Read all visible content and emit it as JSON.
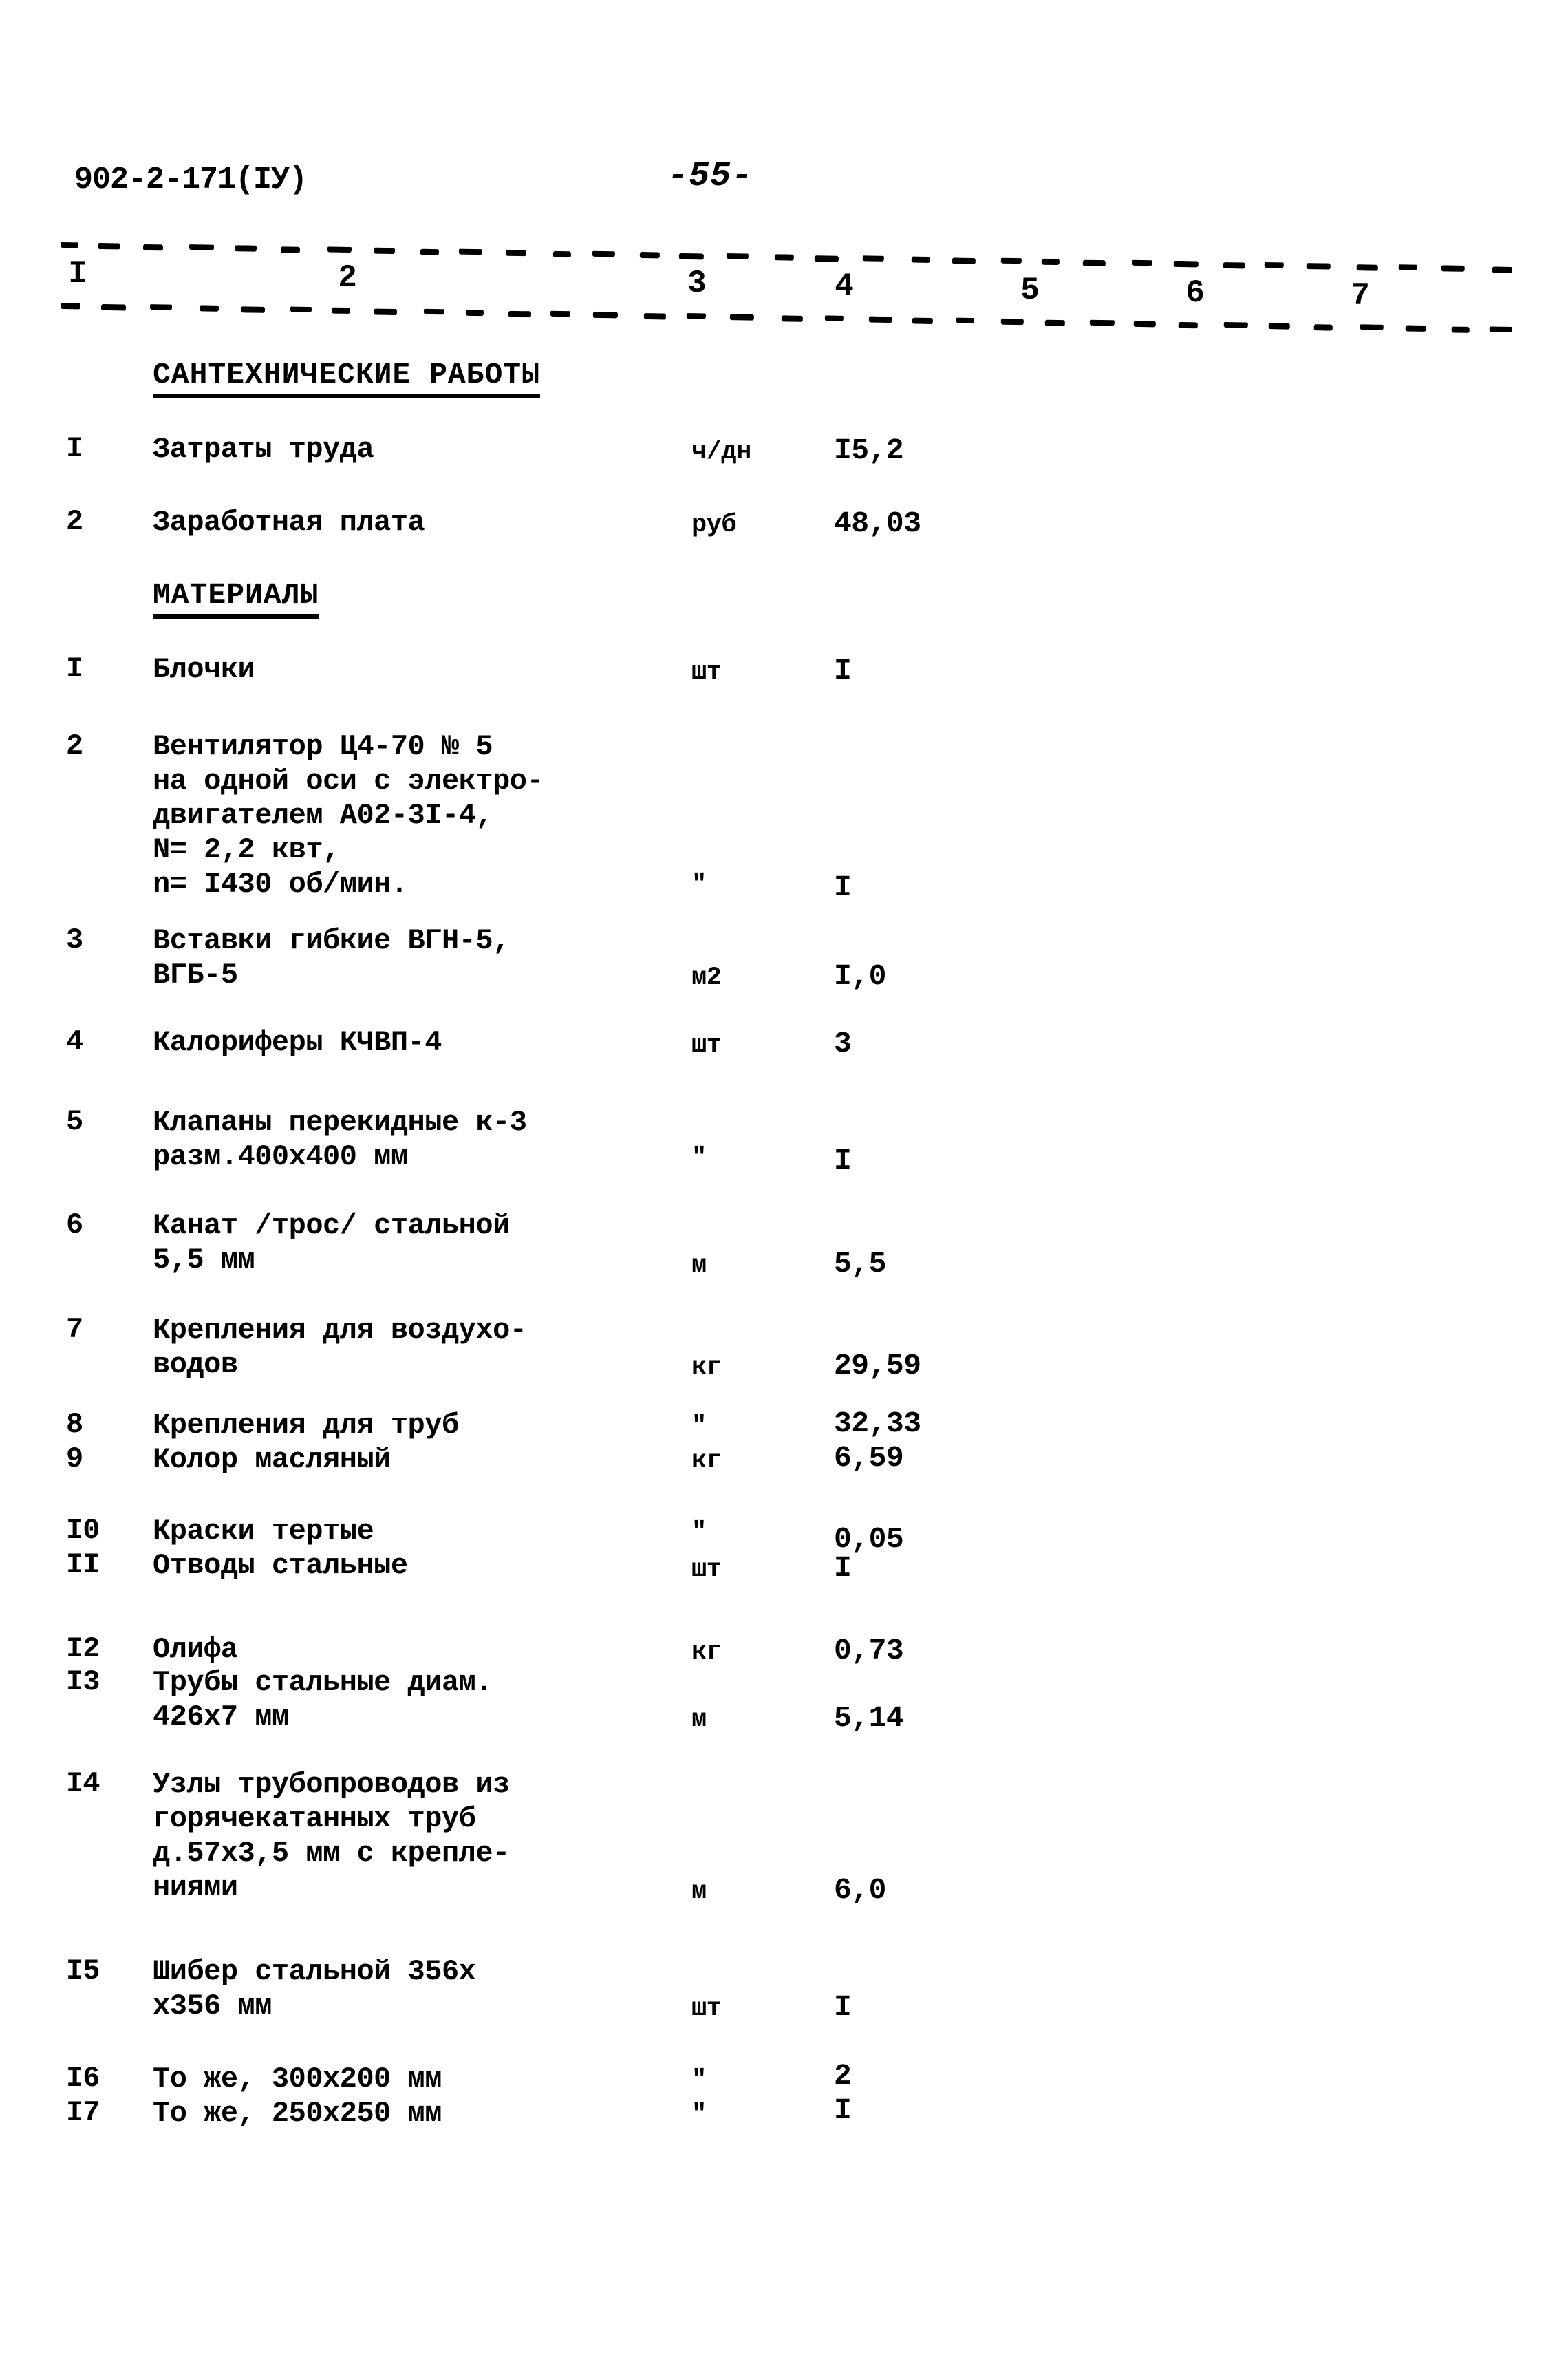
{
  "header": {
    "doc_code": "902-2-171(IУ)",
    "page_number": "-55-"
  },
  "column_headers": [
    "I",
    "2",
    "3",
    "4",
    "5",
    "6",
    "7"
  ],
  "sections": [
    {
      "title": "САНТЕХНИЧЕСКИЕ РАБОТЫ"
    },
    {
      "title": "МАТЕРИАЛЫ"
    }
  ],
  "rows": [
    {
      "num": "I",
      "name": "Затраты труда",
      "unit": "ч/дн",
      "value": "I5,2"
    },
    {
      "num": "2",
      "name": "Заработная плата",
      "unit": "руб",
      "value": "48,03"
    },
    {
      "num": "I",
      "name": "Блочки",
      "unit": "шт",
      "value": "I"
    },
    {
      "num": "2",
      "name": "Вентилятор Ц4-70 № 5\nна одной оси с электро-\nдвигателем А02-3I-4,\nN= 2,2 квт,\nn= I430 об/мин.",
      "unit": "\"",
      "value": "I"
    },
    {
      "num": "3",
      "name": "Вставки гибкие ВГН-5,\nВГБ-5",
      "unit": "м2",
      "value": "I,0"
    },
    {
      "num": "4",
      "name": "Калориферы КЧВП-4",
      "unit": "шт",
      "value": "3"
    },
    {
      "num": "5",
      "name": "Клапаны перекидные к-3\nразм.400х400 мм",
      "unit": "\"",
      "value": "I"
    },
    {
      "num": "6",
      "name": "Канат /трос/ стальной\n5,5 мм",
      "unit": "м",
      "value": "5,5"
    },
    {
      "num": "7",
      "name": "Крепления для воздухо-\nводов",
      "unit": "кг",
      "value": "29,59"
    },
    {
      "num": "8",
      "name": "Крепления для труб",
      "unit": "\"",
      "value": "32,33"
    },
    {
      "num": "9",
      "name": "Колор масляный",
      "unit": "кг",
      "value": "6,59"
    },
    {
      "num": "I0",
      "name": "Краски тертые",
      "unit": "\"",
      "value": "0,05"
    },
    {
      "num": "II",
      "name": "Отводы стальные",
      "unit": "шт",
      "value": "I"
    },
    {
      "num": "I2",
      "name": "Олифа",
      "unit": "кг",
      "value": "0,73"
    },
    {
      "num": "I3",
      "name": "Трубы стальные диам.\n426х7 мм",
      "unit": "м",
      "value": "5,14"
    },
    {
      "num": "I4",
      "name": "Узлы трубопроводов из\nгорячекатанных труб\nд.57х3,5 мм с крепле-\nниями",
      "unit": "м",
      "value": "6,0"
    },
    {
      "num": "I5",
      "name": "Шибер стальной 356х\nх356 мм",
      "unit": "шт",
      "value": "I"
    },
    {
      "num": "I6",
      "name": "То же, 300х200 мм",
      "unit": "\"",
      "value": "2"
    },
    {
      "num": "I7",
      "name": "То же, 250х250 мм",
      "unit": "\"",
      "value": "I"
    }
  ]
}
